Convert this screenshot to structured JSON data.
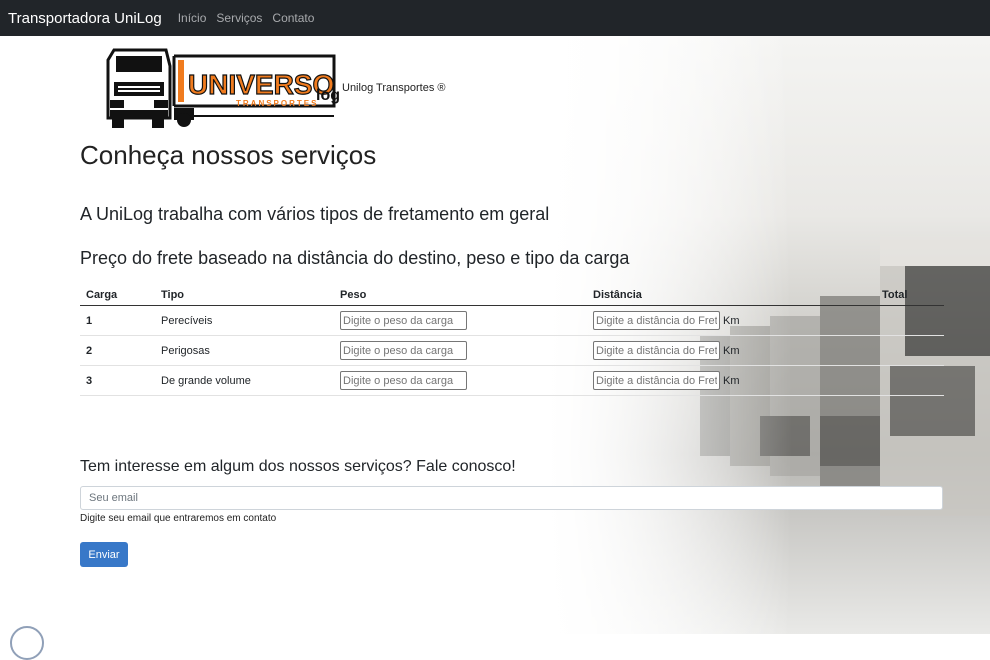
{
  "navbar": {
    "brand": "Transportadora UniLog",
    "links": [
      "Início",
      "Serviços",
      "Contato"
    ]
  },
  "logo": {
    "wordmark": "UNIVERSO",
    "wordmark_suffix": "log",
    "tagline": "TRANSPORTES",
    "caption": "Unilog Transportes ®"
  },
  "page_title": "Conheça nossos serviços",
  "intro": "A UniLog trabalha com vários tipos de fretamento em geral",
  "pricing_title": "Preço do frete baseado na distância do destino, peso e tipo da carga",
  "table": {
    "headers": [
      "Carga",
      "Tipo",
      "Peso",
      "Distância",
      "Total"
    ],
    "rows": [
      {
        "num": "1",
        "tipo": "Perecíveis"
      },
      {
        "num": "2",
        "tipo": "Perigosas"
      },
      {
        "num": "3",
        "tipo": "De grande volume"
      }
    ],
    "weight_placeholder": "Digite o peso da carga",
    "distance_placeholder": "Digite a distância do Frete",
    "distance_unit": "Km"
  },
  "contact": {
    "title": "Tem interesse em algum dos nossos serviços? Fale conosco!",
    "email_placeholder": "Seu email",
    "help": "Digite seu email que entraremos em contato",
    "submit": "Enviar"
  },
  "colors": {
    "navbar": "#212529",
    "button": "#3878c8",
    "logo_orange": "#f07b1e"
  }
}
